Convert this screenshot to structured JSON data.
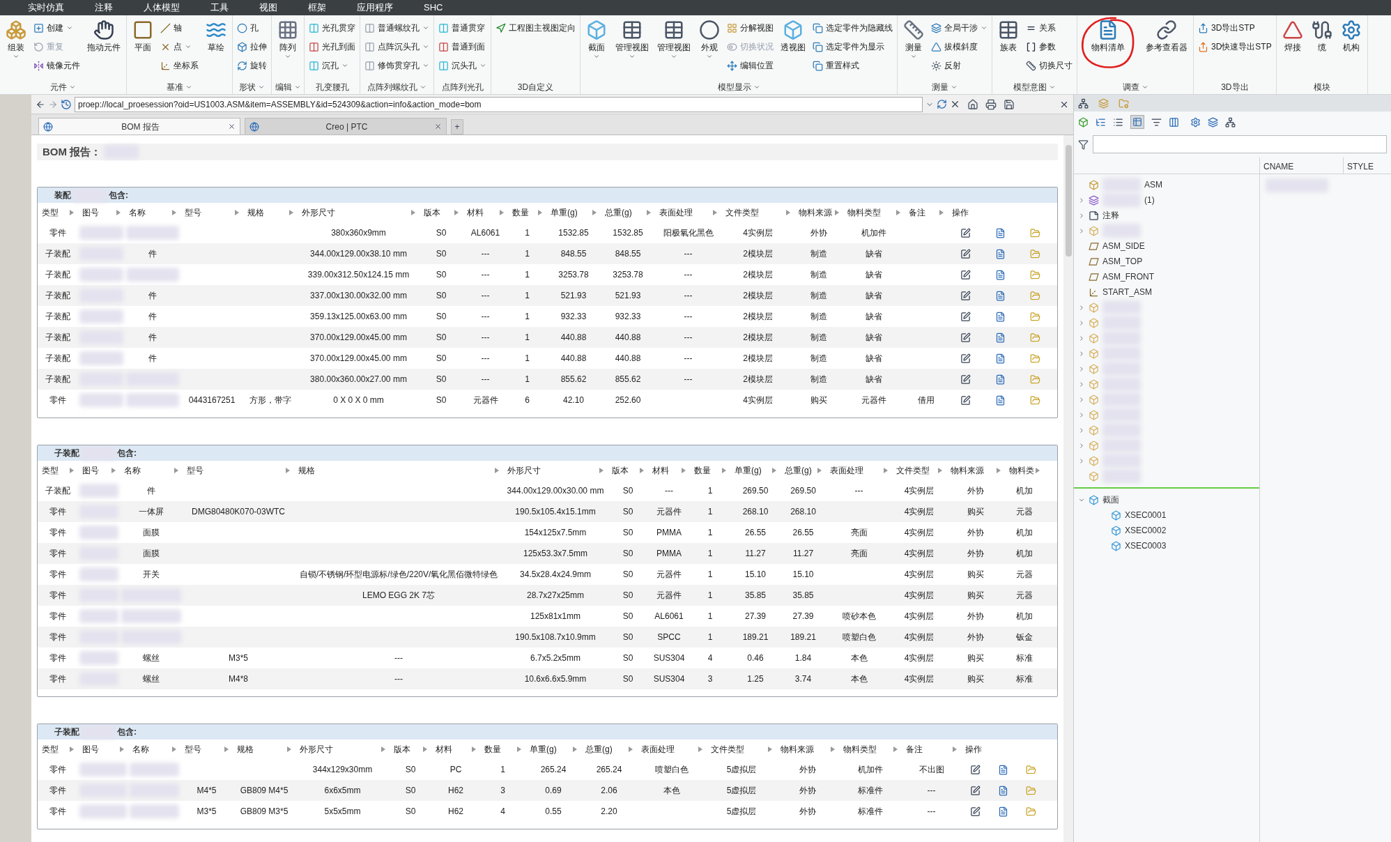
{
  "menu_tabs": [
    "实时仿真",
    "注释",
    "人体模型",
    "工具",
    "视图",
    "框架",
    "应用程序",
    "SHC"
  ],
  "ribbon": {
    "groups": [
      {
        "label": "元件",
        "menu": true,
        "columns": [
          {
            "kind": "big",
            "items": [
              {
                "label": "组装",
                "dropdown": true,
                "disabled": false
              }
            ]
          },
          {
            "kind": "stack",
            "items": [
              {
                "label": "创建",
                "dropdown": true,
                "disabled": false
              },
              {
                "label": "重复",
                "dropdown": false,
                "disabled": true
              },
              {
                "label": "镜像元件",
                "dropdown": false,
                "disabled": false
              }
            ]
          },
          {
            "kind": "big",
            "items": [
              {
                "label": "拖动元件",
                "dropdown": false,
                "disabled": false
              }
            ]
          }
        ]
      },
      {
        "label": "基准",
        "menu": true,
        "columns": [
          {
            "kind": "big",
            "items": [
              {
                "label": "平面",
                "dropdown": false,
                "disabled": false
              }
            ]
          },
          {
            "kind": "stack",
            "items": [
              {
                "label": "轴",
                "dropdown": false,
                "disabled": false
              },
              {
                "label": "点",
                "dropdown": true,
                "disabled": false
              },
              {
                "label": "坐标系",
                "dropdown": false,
                "disabled": false
              }
            ]
          },
          {
            "kind": "big",
            "items": [
              {
                "label": "草绘",
                "dropdown": false,
                "disabled": false
              }
            ]
          }
        ]
      },
      {
        "label": "形状",
        "menu": true,
        "columns": [
          {
            "kind": "stack",
            "items": [
              {
                "label": "孔",
                "dropdown": false,
                "disabled": false
              },
              {
                "label": "拉伸",
                "dropdown": false,
                "disabled": false
              },
              {
                "label": "旋转",
                "dropdown": false,
                "disabled": false
              }
            ]
          }
        ]
      },
      {
        "label": "编辑",
        "menu": true,
        "columns": [
          {
            "kind": "big",
            "items": [
              {
                "label": "阵列",
                "dropdown": true,
                "disabled": false
              }
            ]
          }
        ]
      },
      {
        "label": "孔变腰孔",
        "columns": [
          {
            "kind": "stack",
            "items": [
              {
                "label": "光孔贯穿",
                "dropdown": false,
                "disabled": false
              },
              {
                "label": "光孔到面",
                "dropdown": false,
                "disabled": false
              },
              {
                "label": "沉孔",
                "dropdown": true,
                "disabled": false
              }
            ]
          }
        ]
      },
      {
        "label": "点阵列螺纹孔",
        "menu": true,
        "columns": [
          {
            "kind": "stack",
            "items": [
              {
                "label": "普通螺纹孔",
                "dropdown": true,
                "disabled": false
              },
              {
                "label": "点阵沉头孔",
                "dropdown": true,
                "disabled": false
              },
              {
                "label": "修饰贯穿孔",
                "dropdown": true,
                "disabled": false
              }
            ]
          }
        ]
      },
      {
        "label": "点阵列光孔",
        "columns": [
          {
            "kind": "stack",
            "items": [
              {
                "label": "普通贯穿",
                "dropdown": false,
                "disabled": false
              },
              {
                "label": "普通到面",
                "dropdown": false,
                "disabled": false
              },
              {
                "label": "沉头孔",
                "dropdown": true,
                "disabled": false
              }
            ]
          }
        ]
      },
      {
        "label": "3D自定义",
        "columns": [
          {
            "kind": "stack",
            "items": [
              {
                "label": "工程图主视图定向",
                "dropdown": false,
                "disabled": false
              }
            ]
          }
        ]
      },
      {
        "label": "模型显示",
        "menu": true,
        "columns": [
          {
            "kind": "big",
            "items": [
              {
                "label": "截面",
                "dropdown": true,
                "disabled": false
              }
            ]
          },
          {
            "kind": "big",
            "items": [
              {
                "label": "管理视图",
                "dropdown": true,
                "disabled": false
              }
            ]
          },
          {
            "kind": "big",
            "items": [
              {
                "label": "管理视图",
                "dropdown": true,
                "disabled": false
              }
            ]
          },
          {
            "kind": "big",
            "items": [
              {
                "label": "外观",
                "dropdown": true,
                "disabled": false
              }
            ]
          },
          {
            "kind": "stack",
            "items": [
              {
                "label": "分解视图",
                "dropdown": false,
                "disabled": false
              },
              {
                "label": "切换状况",
                "dropdown": false,
                "disabled": true
              },
              {
                "label": "编辑位置",
                "dropdown": false,
                "disabled": false
              }
            ]
          },
          {
            "kind": "big",
            "items": [
              {
                "label": "透视图",
                "dropdown": false,
                "disabled": false
              }
            ]
          },
          {
            "kind": "stack",
            "items": [
              {
                "label": "选定零件为隐藏线",
                "dropdown": false,
                "disabled": false
              },
              {
                "label": "选定零件为显示",
                "dropdown": false,
                "disabled": false
              },
              {
                "label": "重置样式",
                "dropdown": false,
                "disabled": false
              }
            ]
          }
        ]
      },
      {
        "label": "测量",
        "menu": true,
        "columns": [
          {
            "kind": "big",
            "items": [
              {
                "label": "测量",
                "dropdown": true,
                "disabled": false
              }
            ]
          },
          {
            "kind": "stack",
            "items": [
              {
                "label": "全局干涉",
                "dropdown": true,
                "disabled": false
              },
              {
                "label": "拔模斜度",
                "dropdown": false,
                "disabled": false
              },
              {
                "label": "反射",
                "dropdown": false,
                "disabled": false
              }
            ]
          }
        ]
      },
      {
        "label": "模型意图",
        "menu": true,
        "columns": [
          {
            "kind": "big",
            "items": [
              {
                "label": "族表",
                "dropdown": false,
                "disabled": false
              }
            ]
          },
          {
            "kind": "stack",
            "items": [
              {
                "label": "关系",
                "dropdown": false,
                "disabled": false
              },
              {
                "label": "参数",
                "dropdown": false,
                "disabled": false
              },
              {
                "label": "切换尺寸",
                "dropdown": false,
                "disabled": false
              }
            ]
          }
        ]
      },
      {
        "label": "调查",
        "menu": true,
        "columns": [
          {
            "kind": "big",
            "items": [
              {
                "label": "物料清单",
                "dropdown": false,
                "disabled": false,
                "circled": true
              }
            ]
          },
          {
            "kind": "big",
            "items": [
              {
                "label": "参考查看器",
                "dropdown": false,
                "disabled": false
              }
            ]
          }
        ]
      },
      {
        "label": "3D导出",
        "columns": [
          {
            "kind": "stack",
            "items": [
              {
                "label": "3D导出STP",
                "dropdown": false,
                "disabled": false
              },
              {
                "label": "3D快速导出STP",
                "dropdown": false,
                "disabled": false
              }
            ]
          }
        ]
      },
      {
        "label": "模块",
        "columns": [
          {
            "kind": "big",
            "items": [
              {
                "label": "焊接",
                "dropdown": false,
                "disabled": false
              }
            ]
          },
          {
            "kind": "big",
            "items": [
              {
                "label": "缆",
                "dropdown": false,
                "disabled": false
              }
            ]
          },
          {
            "kind": "big",
            "items": [
              {
                "label": "机构",
                "dropdown": false,
                "disabled": false
              }
            ]
          }
        ]
      }
    ]
  },
  "address_bar": {
    "url": "proep://local_proesession?oid=US1003.ASM&item=ASSEMBLY&id=524309&action=info&action_mode=bom"
  },
  "browser_tabs": [
    {
      "label": "BOM 报告",
      "selected": true
    },
    {
      "label": "Creo | PTC",
      "selected": false
    }
  ],
  "new_tab": "+",
  "report": {
    "title": "BOM 报告：",
    "sections": [
      {
        "title_prefix": "装配",
        "title_suffix": "包含:",
        "actions": true,
        "actions_label": "操作",
        "columns": [
          "类型",
          "图号",
          "名称",
          "型号",
          "规格",
          "外形尺寸",
          "版本",
          "材料",
          "数量",
          "单重(g)",
          "总重(g)",
          "表面处理",
          "文件类型",
          "物料来源",
          "物料类型",
          "备注"
        ],
        "rows": [
          [
            "零件",
            null,
            null,
            null,
            null,
            "380x360x9mm",
            "S0",
            "AL6061",
            "1",
            "1532.85",
            "1532.85",
            "阳极氧化黑色",
            "4实例层",
            "外协",
            "机加件",
            null
          ],
          [
            "子装配",
            null,
            "件",
            null,
            null,
            "344.00x129.00x38.10 mm",
            "S0",
            "---",
            "1",
            "848.55",
            "848.55",
            "---",
            "2模块层",
            "制造",
            "缺省",
            null
          ],
          [
            "子装配",
            null,
            null,
            null,
            null,
            "339.00x312.50x124.15 mm",
            "S0",
            "---",
            "1",
            "3253.78",
            "3253.78",
            "---",
            "2模块层",
            "制造",
            "缺省",
            null
          ],
          [
            "子装配",
            null,
            "件",
            null,
            null,
            "337.00x130.00x32.00 mm",
            "S0",
            "---",
            "1",
            "521.93",
            "521.93",
            "---",
            "2模块层",
            "制造",
            "缺省",
            null
          ],
          [
            "子装配",
            null,
            "件",
            null,
            null,
            "359.13x125.00x63.00 mm",
            "S0",
            "---",
            "1",
            "932.33",
            "932.33",
            "---",
            "2模块层",
            "制造",
            "缺省",
            null
          ],
          [
            "子装配",
            null,
            "件",
            null,
            null,
            "370.00x129.00x45.00 mm",
            "S0",
            "---",
            "1",
            "440.88",
            "440.88",
            "---",
            "2模块层",
            "制造",
            "缺省",
            null
          ],
          [
            "子装配",
            null,
            "件",
            null,
            null,
            "370.00x129.00x45.00 mm",
            "S0",
            "---",
            "1",
            "440.88",
            "440.88",
            "---",
            "2模块层",
            "制造",
            "缺省",
            null
          ],
          [
            "子装配",
            null,
            null,
            null,
            null,
            "380.00x360.00x27.00 mm",
            "S0",
            "---",
            "1",
            "855.62",
            "855.62",
            "---",
            "2模块层",
            "制造",
            "缺省",
            null
          ],
          [
            "零件",
            null,
            null,
            "0443167251",
            "方形，带字",
            "0 X 0 X 0 mm",
            "S0",
            "元器件",
            "6",
            "42.10",
            "252.60",
            null,
            "4实例层",
            "购买",
            "元器件",
            "借用"
          ]
        ]
      },
      {
        "title_prefix": "子装配",
        "title_suffix": "包含:",
        "actions": false,
        "columns": [
          "类型",
          "图号",
          "名称",
          "型号",
          "规格",
          "外形尺寸",
          "版本",
          "材料",
          "数量",
          "单重(g)",
          "总重(g)",
          "表面处理",
          "文件类型",
          "物料来源",
          "物料类"
        ],
        "rows": [
          [
            "子装配",
            null,
            "件",
            null,
            null,
            "344.00x129.00x30.00 mm",
            "S0",
            "---",
            "1",
            "269.50",
            "269.50",
            "---",
            "4实例层",
            "外协",
            "机加"
          ],
          [
            "零件",
            null,
            "一体屏",
            "DMG80480K070-03WTC",
            null,
            "190.5x105.4x15.1mm",
            "S0",
            "元器件",
            "1",
            "268.10",
            "268.10",
            null,
            "4实例层",
            "购买",
            "元器"
          ],
          [
            "零件",
            null,
            "面膜",
            null,
            null,
            "154x125x7.5mm",
            "S0",
            "PMMA",
            "1",
            "26.55",
            "26.55",
            "亮面",
            "4实例层",
            "外协",
            "机加"
          ],
          [
            "零件",
            null,
            "面膜",
            null,
            null,
            "125x53.3x7.5mm",
            "S0",
            "PMMA",
            "1",
            "11.27",
            "11.27",
            "亮面",
            "4实例层",
            "外协",
            "机加"
          ],
          [
            "零件",
            null,
            "开关",
            null,
            "自锁/不锈钢/环型电源标/绿色/220V/氧化黑佰微特绿色",
            "34.5x28.4x24.9mm",
            "S0",
            "元器件",
            "1",
            "15.10",
            "15.10",
            null,
            "4实例层",
            "购买",
            "元器"
          ],
          [
            "零件",
            null,
            null,
            null,
            "LEMO EGG 2K 7芯",
            "28.7x27x25mm",
            "S0",
            "元器件",
            "1",
            "35.85",
            "35.85",
            null,
            "4实例层",
            "购买",
            "元器"
          ],
          [
            "零件",
            null,
            null,
            null,
            null,
            "125x81x1mm",
            "S0",
            "AL6061",
            "1",
            "27.39",
            "27.39",
            "喷砂本色",
            "4实例层",
            "外协",
            "机加"
          ],
          [
            "零件",
            null,
            null,
            null,
            null,
            "190.5x108.7x10.9mm",
            "S0",
            "SPCC",
            "1",
            "189.21",
            "189.21",
            "喷塑白色",
            "4实例层",
            "外协",
            "钣金"
          ],
          [
            "零件",
            null,
            "螺丝",
            "M3*5",
            "---",
            "6.7x5.2x5mm",
            "S0",
            "SUS304",
            "4",
            "0.46",
            "1.84",
            "本色",
            "4实例层",
            "购买",
            "标准"
          ],
          [
            "零件",
            null,
            "螺丝",
            "M4*8",
            "---",
            "10.6x6.6x5.9mm",
            "S0",
            "SUS304",
            "3",
            "1.25",
            "3.74",
            "本色",
            "4实例层",
            "购买",
            "标准"
          ]
        ]
      },
      {
        "title_prefix": "子装配",
        "title_suffix": "包含:",
        "actions": true,
        "actions_label": "操作",
        "columns": [
          "类型",
          "图号",
          "名称",
          "型号",
          "规格",
          "外形尺寸",
          "版本",
          "材料",
          "数量",
          "单重(g)",
          "总重(g)",
          "表面处理",
          "文件类型",
          "物料来源",
          "物料类型",
          "备注"
        ],
        "rows": [
          [
            "零件",
            null,
            null,
            null,
            null,
            "344x129x30mm",
            "S0",
            "PC",
            "1",
            "265.24",
            "265.24",
            "喷塑白色",
            "5虚拟层",
            "外协",
            "机加件",
            "不出图"
          ],
          [
            "零件",
            null,
            null,
            "M4*5",
            "GB809 M4*5",
            "6x6x5mm",
            "S0",
            "H62",
            "3",
            "0.69",
            "2.06",
            "本色",
            "5虚拟层",
            "外协",
            "标准件",
            "---"
          ],
          [
            "零件",
            null,
            null,
            "M3*5",
            "GB809 M3*5",
            "5x5x5mm",
            "S0",
            "H62",
            "4",
            "0.55",
            "2.20",
            null,
            "5虚拟层",
            "外协",
            "标准件",
            "---"
          ]
        ]
      }
    ]
  },
  "model_tree": {
    "columns": [
      "CNAME",
      "STYLE"
    ],
    "items": [
      {
        "kind": "asm",
        "label": "ASM"
      },
      {
        "kind": "layers",
        "label": "(1)",
        "expanded": false
      },
      {
        "kind": "note",
        "label": "注释",
        "expanded": false
      },
      {
        "kind": "part",
        "expanded": false
      },
      {
        "kind": "plane",
        "label": "ASM_SIDE"
      },
      {
        "kind": "plane",
        "label": "ASM_TOP"
      },
      {
        "kind": "plane",
        "label": "ASM_FRONT"
      },
      {
        "kind": "csys",
        "label": "START_ASM"
      },
      {
        "kind": "part",
        "expanded": false
      },
      {
        "kind": "part",
        "expanded": false
      },
      {
        "kind": "part",
        "expanded": false
      },
      {
        "kind": "part",
        "expanded": false
      },
      {
        "kind": "part",
        "expanded": false
      },
      {
        "kind": "part",
        "expanded": false
      },
      {
        "kind": "part",
        "expanded": false
      },
      {
        "kind": "part",
        "expanded": false
      },
      {
        "kind": "part",
        "expanded": false
      },
      {
        "kind": "part",
        "expanded": false
      },
      {
        "kind": "part",
        "expanded": false
      },
      {
        "kind": "part"
      },
      {
        "kind": "separator"
      },
      {
        "kind": "xsec",
        "label": "截面",
        "expanded": true,
        "children": [
          {
            "kind": "xsec",
            "label": "XSEC0001"
          },
          {
            "kind": "xsec",
            "label": "XSEC0002"
          },
          {
            "kind": "xsec",
            "label": "XSEC0003"
          }
        ]
      }
    ]
  }
}
